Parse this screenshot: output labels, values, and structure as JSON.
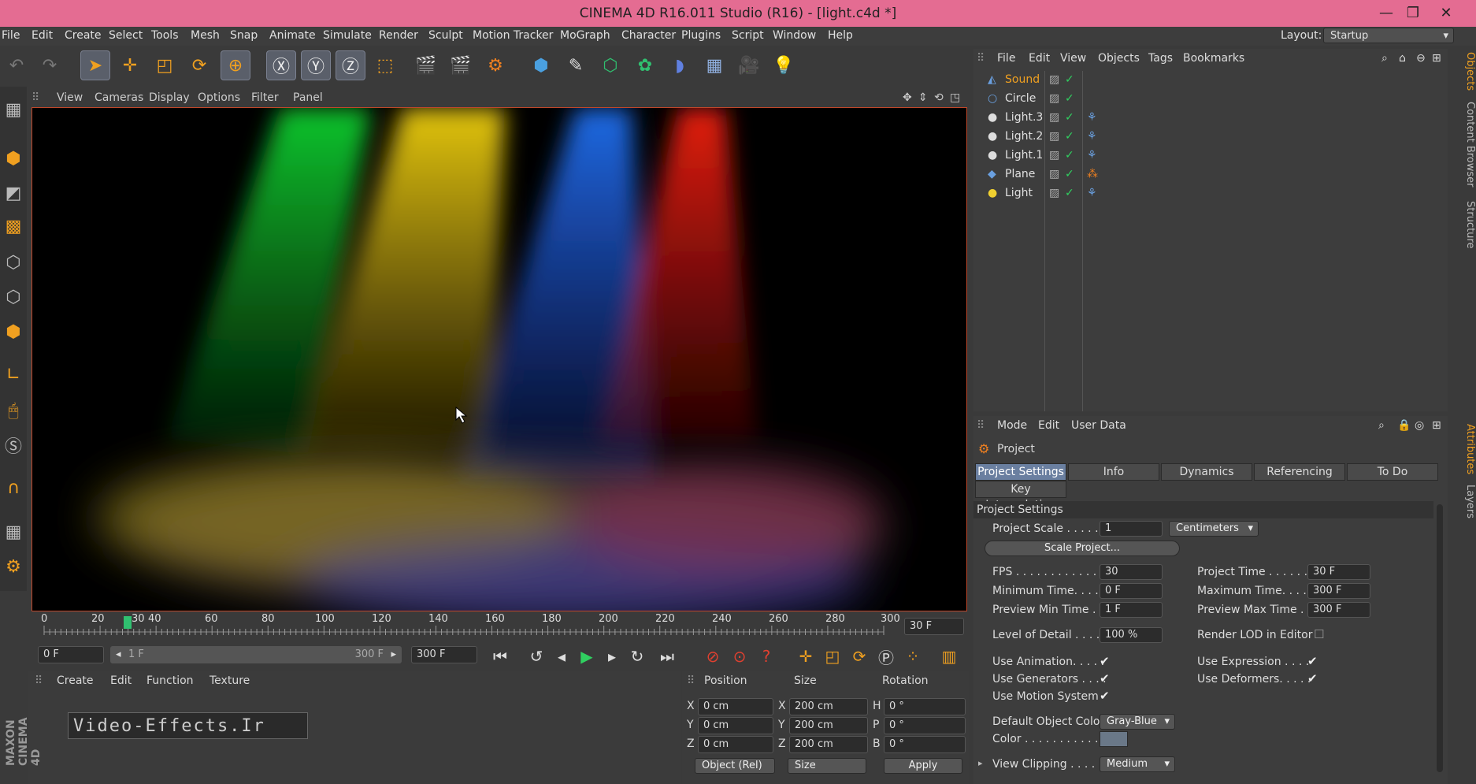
{
  "window": {
    "title": "CINEMA 4D R16.011 Studio (R16) - [light.c4d *]"
  },
  "menubar": {
    "items": [
      "File",
      "Edit",
      "Create",
      "Select",
      "Tools",
      "Mesh",
      "Snap",
      "Animate",
      "Simulate",
      "Render",
      "Sculpt",
      "Motion Tracker",
      "MoGraph",
      "Character",
      "Plugins",
      "Script",
      "Window",
      "Help"
    ],
    "layout_label": "Layout:",
    "layout_value": "Startup"
  },
  "viewport": {
    "menu": [
      "View",
      "Cameras",
      "Display",
      "Options",
      "Filter",
      "Panel"
    ]
  },
  "timeline": {
    "ticks": [
      "0",
      "20",
      "30",
      "40",
      "60",
      "80",
      "100",
      "120",
      "140",
      "160",
      "180",
      "200",
      "220",
      "240",
      "260",
      "280",
      "300"
    ],
    "current": "30 F",
    "start_field": "0 F",
    "range_start": "1 F",
    "range_end": "300 F",
    "end_field": "300 F"
  },
  "material_manager": {
    "menu": [
      "Create",
      "Edit",
      "Function",
      "Texture"
    ]
  },
  "coords": {
    "headers": [
      "Position",
      "Size",
      "Rotation"
    ],
    "rows": [
      {
        "axis": "X",
        "pos": "0 cm",
        "size_axis": "X",
        "size": "200 cm",
        "rot_axis": "H",
        "rot": "0 °"
      },
      {
        "axis": "Y",
        "pos": "0 cm",
        "size_axis": "Y",
        "size": "200 cm",
        "rot_axis": "P",
        "rot": "0 °"
      },
      {
        "axis": "Z",
        "pos": "0 cm",
        "size_axis": "Z",
        "size": "200 cm",
        "rot_axis": "B",
        "rot": "0 °"
      }
    ],
    "mode": "Object (Rel)",
    "size_mode": "Size",
    "apply": "Apply"
  },
  "object_manager": {
    "menu": [
      "File",
      "Edit",
      "View",
      "Objects",
      "Tags",
      "Bookmarks"
    ],
    "objects": [
      {
        "name": "Sound",
        "highlight": true
      },
      {
        "name": "Circle",
        "highlight": false
      },
      {
        "name": "Light.3",
        "highlight": false
      },
      {
        "name": "Light.2",
        "highlight": false
      },
      {
        "name": "Light.1",
        "highlight": false
      },
      {
        "name": "Plane",
        "highlight": false
      },
      {
        "name": "Light",
        "highlight": false
      }
    ]
  },
  "attribute_manager": {
    "menu": [
      "Mode",
      "Edit",
      "User Data"
    ],
    "object": "Project",
    "tabs": [
      "Project Settings",
      "Info",
      "Dynamics",
      "Referencing",
      "To Do"
    ],
    "subtab": "Key Interpolation",
    "section": "Project Settings",
    "project_scale_label": "Project Scale . . . . . .",
    "project_scale": "1",
    "units": "Centimeters",
    "scale_project": "Scale Project...",
    "fps_label": "FPS . . . . . . . . . . . . . .",
    "fps": "30",
    "project_time_label": "Project Time . . . . . . . .",
    "project_time": "30 F",
    "min_time_label": "Minimum Time. . . . . .",
    "min_time": "0 F",
    "max_time_label": "Maximum Time. . . . . .",
    "max_time": "300 F",
    "prev_min_label": "Preview Min Time . .",
    "prev_min": "1 F",
    "prev_max_label": "Preview Max Time . . .",
    "prev_max": "300 F",
    "lod_label": "Level of Detail . . . . .",
    "lod": "100 %",
    "render_lod_label": "Render LOD in Editor",
    "use_animation": "Use Animation. . . . .",
    "use_expression": "Use Expression . . . .",
    "use_generators": "Use Generators . . . .",
    "use_deformers": "Use Deformers. . . . .",
    "use_motion": "Use Motion System",
    "default_color_label": "Default Object Color",
    "default_color": "Gray-Blue",
    "color_label": "Color . . . . . . . . . . .",
    "view_clipping_label": "View Clipping . . . . .",
    "view_clipping": "Medium"
  },
  "right_tabs": [
    "Objects",
    "Content Browser",
    "Structure",
    "Attributes",
    "Layers"
  ],
  "watermark": "Video-Effects.Ir",
  "logo": "MAXON CINEMA 4D",
  "colors": {
    "title_bar": "#e46c92",
    "accent": "#f0a020",
    "selected_tab": "#6a7fa0"
  }
}
